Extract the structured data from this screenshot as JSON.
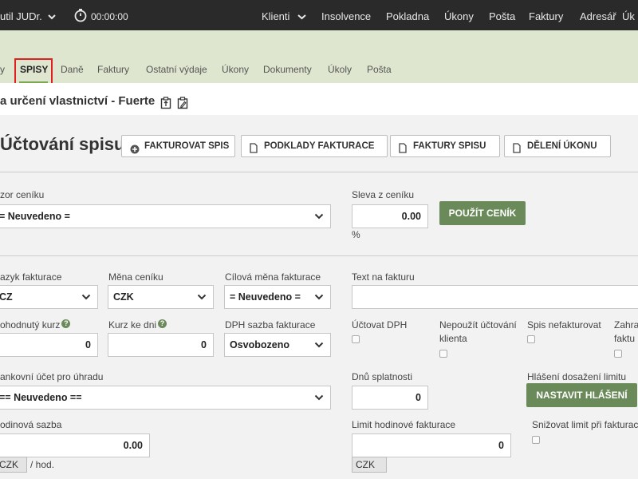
{
  "topbar": {
    "user": "util JUDr.",
    "timer": "00:00:00",
    "nav": [
      "Klienti",
      "Insolvence",
      "Pokladna",
      "Úkony",
      "Pošta",
      "Faktury",
      "Adresář",
      "Úk"
    ]
  },
  "subnav": {
    "items": [
      "y",
      "SPISY",
      "Daně",
      "Faktury",
      "Ostatní výdaje",
      "Úkony",
      "Dokumenty",
      "Úkoly",
      "Pošta"
    ]
  },
  "header": {
    "title": "a určení vlastnictví - Fuerte"
  },
  "section": {
    "title": "Účtování spisu",
    "buttons": [
      "FAKTUROVAT SPIS",
      "PODKLADY FAKTURACE",
      "FAKTURY SPISU",
      "DĚLENÍ ÚKONU"
    ]
  },
  "form": {
    "vzor_label": "zor ceníku",
    "vzor_value": "= Neuvedeno =",
    "sleva_label": "Sleva z ceníku",
    "sleva_value": "0.00",
    "sleva_unit": "%",
    "pouzit_btn": "POUŽÍT CENÍK",
    "jazyk_label": "azyk fakturace",
    "jazyk_value": "CZ",
    "mena_label": "Měna ceníku",
    "mena_value": "CZK",
    "cilova_label": "Cílová měna fakturace",
    "cilova_value": "= Neuvedeno =",
    "text_label": "Text na fakturu",
    "text_value": "",
    "kurz_label": "ohodnutý kurz",
    "kurz_value": "0",
    "kurzdni_label": "Kurz ke dni",
    "kurzdni_value": "0",
    "dph_label": "DPH sazba fakturace",
    "dph_value": "Osvobozeno",
    "uctovat_dph": "Účtovat DPH",
    "nepouzit": "Nepoužít účtování",
    "klienta": "klienta",
    "spis_nefakt": "Spis nefakturovat",
    "zahr": "Zahra",
    "faktu": "faktu",
    "ucet_label": "ankovní účet pro úhradu",
    "ucet_value": "== Neuvedeno ==",
    "splatnost_label": "Dnů splatnosti",
    "splatnost_value": "0",
    "hlaseni_label": "Hlášení dosažení limitu",
    "hlaseni_btn": "NASTAVIT HLÁŠENÍ",
    "hodinova_label": "odinová sazba",
    "hodinova_value": "0.00",
    "hodinova_currency": "CZK",
    "hodinova_unit": "/ hod.",
    "limit_label": "Limit hodinové fakturace",
    "limit_value": "0",
    "limit_currency": "CZK",
    "snizovat_label": "Snižovat limit při fakturaci"
  },
  "icons": [
    "timer-icon",
    "chevron-down-icon",
    "plus-circle-icon",
    "document-icon",
    "help-icon",
    "copy-icon",
    "edit-icon"
  ],
  "colors": {
    "topbar": "#2a2a2a",
    "subnav": "#dfe6cf",
    "accent_green": "#6b8a5a",
    "highlight_red": "#e02020"
  }
}
